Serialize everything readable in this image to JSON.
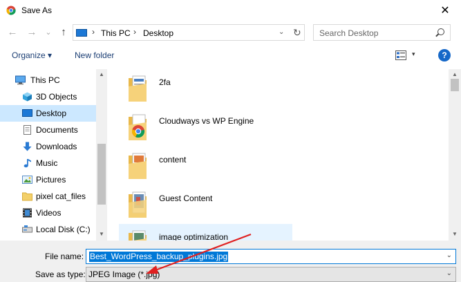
{
  "window": {
    "title": "Save As",
    "close_glyph": "✕"
  },
  "nav_buttons": {
    "back": "←",
    "forward": "→",
    "recent": "⌄",
    "up": "↑"
  },
  "address": {
    "crumbs": [
      "This PC",
      "Desktop"
    ],
    "separator": "›",
    "dropdown_glyph": "⌄",
    "refresh_glyph": "↻"
  },
  "search": {
    "placeholder": "Search Desktop"
  },
  "toolbar": {
    "organize": "Organize ▾",
    "new_folder": "New folder",
    "view_dropdown": "▾",
    "help": "?"
  },
  "nav_pane": {
    "items": [
      {
        "label": "This PC",
        "icon": "computer-icon",
        "selected": false
      },
      {
        "label": "3D Objects",
        "icon": "cube-icon",
        "selected": false
      },
      {
        "label": "Desktop",
        "icon": "desktop-icon",
        "selected": true
      },
      {
        "label": "Documents",
        "icon": "documents-icon",
        "selected": false
      },
      {
        "label": "Downloads",
        "icon": "download-arrow-icon",
        "selected": false
      },
      {
        "label": "Music",
        "icon": "music-note-icon",
        "selected": false
      },
      {
        "label": "Pictures",
        "icon": "pictures-icon",
        "selected": false
      },
      {
        "label": "pixel cat_files",
        "icon": "folder-icon",
        "selected": false
      },
      {
        "label": "Videos",
        "icon": "film-icon",
        "selected": false
      },
      {
        "label": "Local Disk (C:)",
        "icon": "hard-disk-icon",
        "selected": false
      }
    ]
  },
  "files": [
    {
      "name": "2fa",
      "icon": "folder-with-document-icon"
    },
    {
      "name": "Cloudways vs WP Engine",
      "icon": "folder-with-chrome-icon"
    },
    {
      "name": "content",
      "icon": "folder-with-document-icon"
    },
    {
      "name": "Guest Content",
      "icon": "folder-with-photo-icon"
    },
    {
      "name": "image optimization",
      "icon": "folder-with-photo-icon"
    }
  ],
  "form": {
    "file_name_label": "File name:",
    "file_name_value": "Best_WordPress_backup_plugins.jpg",
    "save_type_label": "Save as type:",
    "save_type_value": "JPEG Image (*.jpg)",
    "dropdown_glyph": "⌄"
  },
  "colors": {
    "selection": "#cce8ff",
    "hover": "#e5f3ff",
    "accent": "#0078d7",
    "annotation": "#e02020"
  }
}
